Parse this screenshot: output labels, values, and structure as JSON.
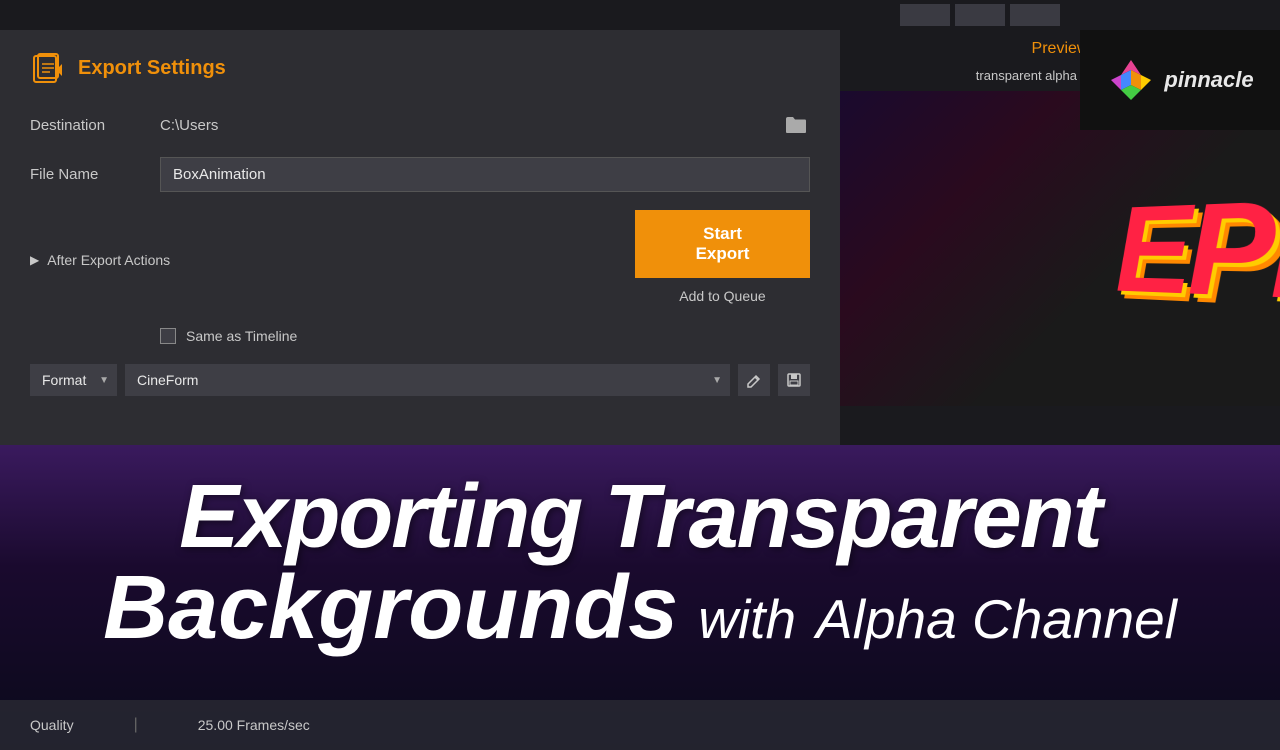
{
  "topBar": {
    "buttons": [
      "btn1",
      "btn2",
      "btn3"
    ]
  },
  "exportPanel": {
    "title": "Export Settings",
    "destinationLabel": "Destination",
    "destinationValue": "C:\\Users",
    "fileNameLabel": "File Name",
    "fileNameValue": "BoxAnimation",
    "afterExportLabel": "After Export Actions",
    "startExportLabel": "Start Export",
    "addToQueueLabel": "Add to Queue",
    "sameAsTimelineLabel": "Same as Timeline",
    "formatLabel": "Format",
    "formatValue": "CineForm"
  },
  "preview": {
    "title": "Preview",
    "filename": "transparent alpha channel.r...",
    "epsText": "EPI"
  },
  "pinnacle": {
    "text": "pinnacle"
  },
  "bottomTitle": {
    "line1": "Exporting Transparent",
    "line2": "Backgrounds",
    "with": "with",
    "alphaChannel": "Alpha Channel"
  },
  "footer": {
    "quality": "Quality",
    "fps": "25.00 Frames/sec"
  }
}
